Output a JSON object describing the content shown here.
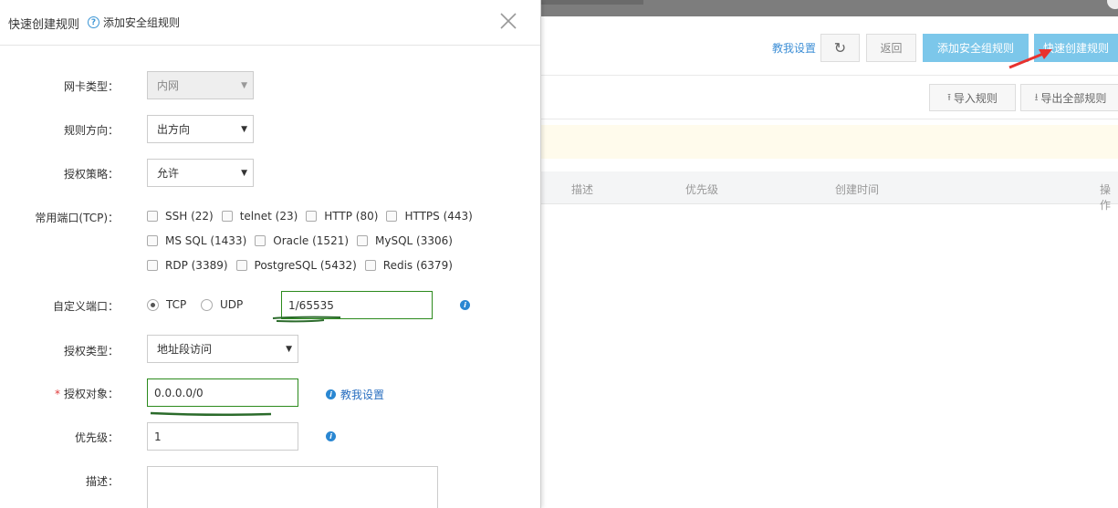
{
  "background": {
    "help_link": "教我设置",
    "refresh_icon": "refresh-icon",
    "back_label": "返回",
    "add_rule_label": "添加安全组规则",
    "quick_create_label": "快速创建规则",
    "import_label": "导入规则",
    "export_label": "导出全部规则",
    "table_headers": [
      "描述",
      "优先级",
      "创建时间",
      "操作"
    ]
  },
  "dialog": {
    "title": "快速创建规则",
    "help_link": "添加安全组规则",
    "fields": {
      "nic_type": {
        "label": "网卡类型：",
        "value": "内网"
      },
      "direction": {
        "label": "规则方向：",
        "value": "出方向"
      },
      "policy": {
        "label": "授权策略：",
        "value": "允许"
      },
      "common_ports": {
        "label": "常用端口(TCP)：",
        "rows": [
          [
            "SSH (22)",
            "telnet (23)",
            "HTTP (80)",
            "HTTPS (443)"
          ],
          [
            "MS SQL (1433)",
            "Oracle (1521)",
            "MySQL (3306)"
          ],
          [
            "RDP (3389)",
            "PostgreSQL (5432)",
            "Redis (6379)"
          ]
        ]
      },
      "custom_port": {
        "label": "自定义端口：",
        "tcp": "TCP",
        "udp": "UDP",
        "value": "1/65535"
      },
      "auth_type": {
        "label": "授权类型：",
        "value": "地址段访问"
      },
      "auth_object": {
        "required_mark": "*",
        "label": "授权对象：",
        "value": "0.0.0.0/0",
        "help": "教我设置"
      },
      "priority": {
        "label": "优先级：",
        "value": "1"
      },
      "description": {
        "label": "描述：",
        "value": ""
      }
    }
  },
  "colors": {
    "primary_button": "#7cc7ea",
    "link": "#2a6fc0",
    "highlight_border": "#2b8a1c",
    "annotation_arrow": "#e8322e"
  }
}
